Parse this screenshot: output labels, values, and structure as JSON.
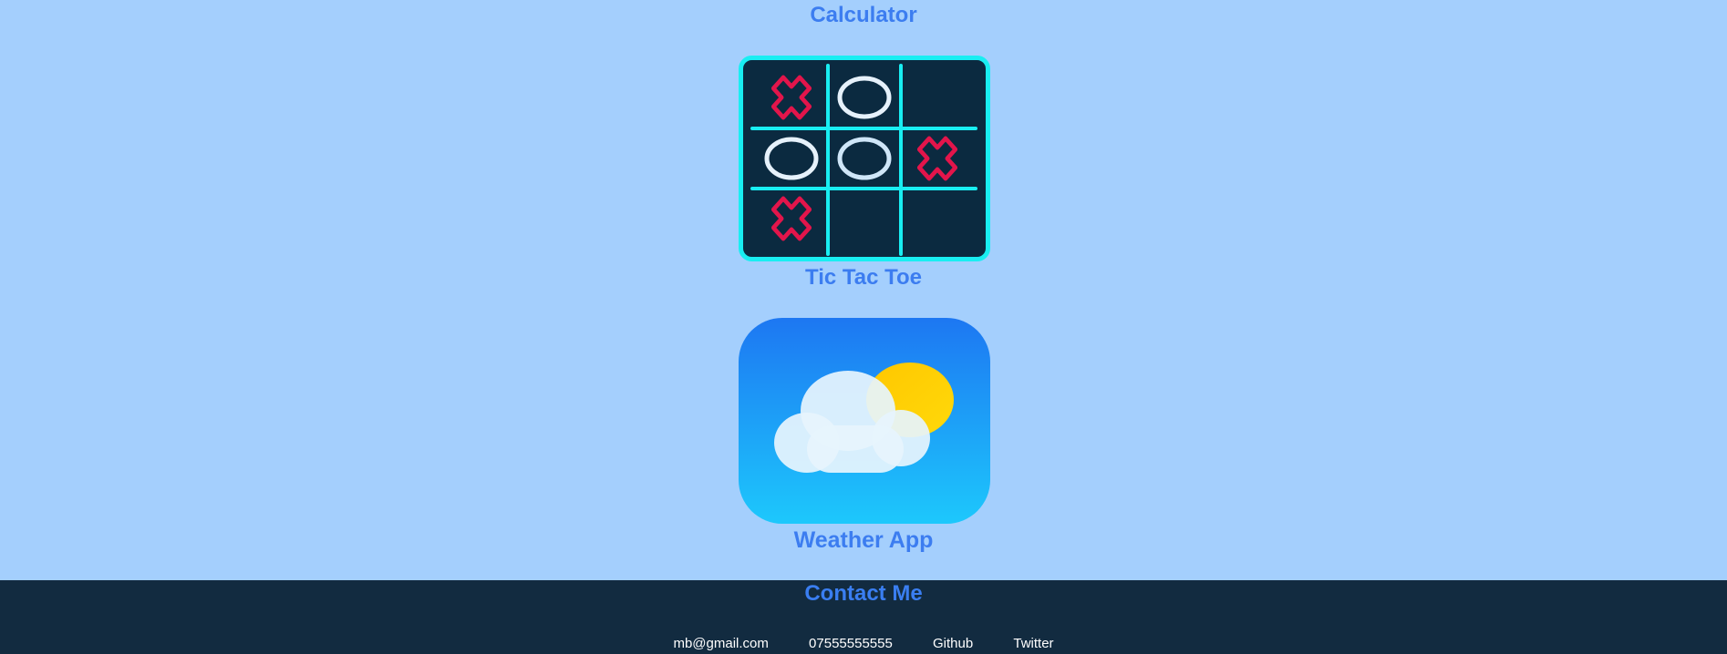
{
  "projects": {
    "calculator": {
      "title": "Calculator"
    },
    "tictactoe": {
      "title": "Tic Tac Toe"
    },
    "weather": {
      "title": "Weather App"
    }
  },
  "colors": {
    "background": "#a4cffd",
    "title": "#3c7df0",
    "footer": "#122b40",
    "ttt_board": "#0b2a40",
    "ttt_lines": "#19eef2",
    "ttt_x": "#e3154b",
    "ttt_o": "#e6f1fb"
  },
  "icons": {
    "tictactoe": "tic-tac-toe-board-icon",
    "weather": "weather-cloud-sun-icon"
  },
  "footer": {
    "title": "Contact Me",
    "email": "mb@gmail.com",
    "phone": "07555555555",
    "github": "Github",
    "twitter": "Twitter"
  }
}
